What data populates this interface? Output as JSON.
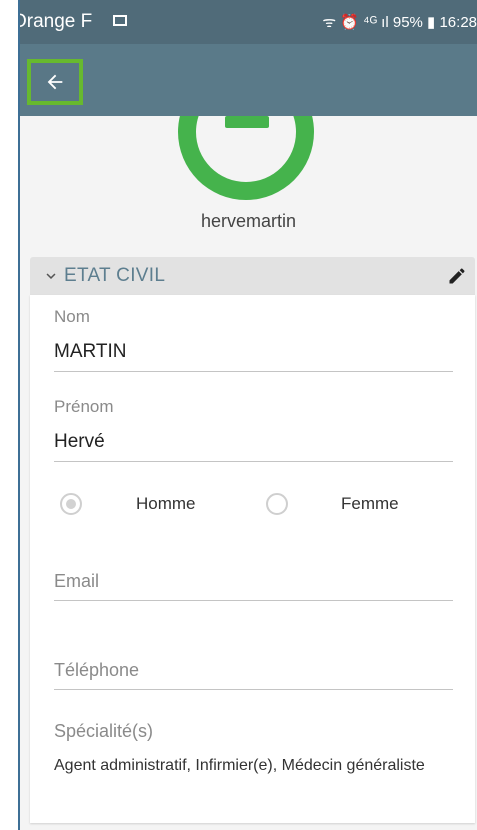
{
  "status_bar": {
    "carrier": "Orange F",
    "right_text": "ᯤ ⏰ ⁴ᴳ ıl 95% ▮ 16:28"
  },
  "app_bar": {
    "back_icon": "arrow-left-icon"
  },
  "profile": {
    "username": "hervemartin"
  },
  "section": {
    "title": "ETAT CIVIL",
    "chevron_icon": "chevron-down-icon",
    "edit_icon": "pencil-icon"
  },
  "fields": {
    "nom": {
      "label": "Nom",
      "value": "MARTIN"
    },
    "prenom": {
      "label": "Prénom",
      "value": "Hervé"
    },
    "gender": {
      "options": [
        {
          "label": "Homme",
          "selected": true
        },
        {
          "label": "Femme",
          "selected": false
        }
      ]
    },
    "email": {
      "placeholder": "Email",
      "value": ""
    },
    "telephone": {
      "placeholder": "Téléphone",
      "value": ""
    },
    "specialites": {
      "label": "Spécialité(s)",
      "value": "Agent administratif, Infirmier(e), Médecin généraliste"
    }
  },
  "colors": {
    "status_bar": "#506b79",
    "app_bar": "#5a7a89",
    "highlight": "#67b92e",
    "avatar": "#45b34c",
    "section_title": "#5d7e8f"
  }
}
